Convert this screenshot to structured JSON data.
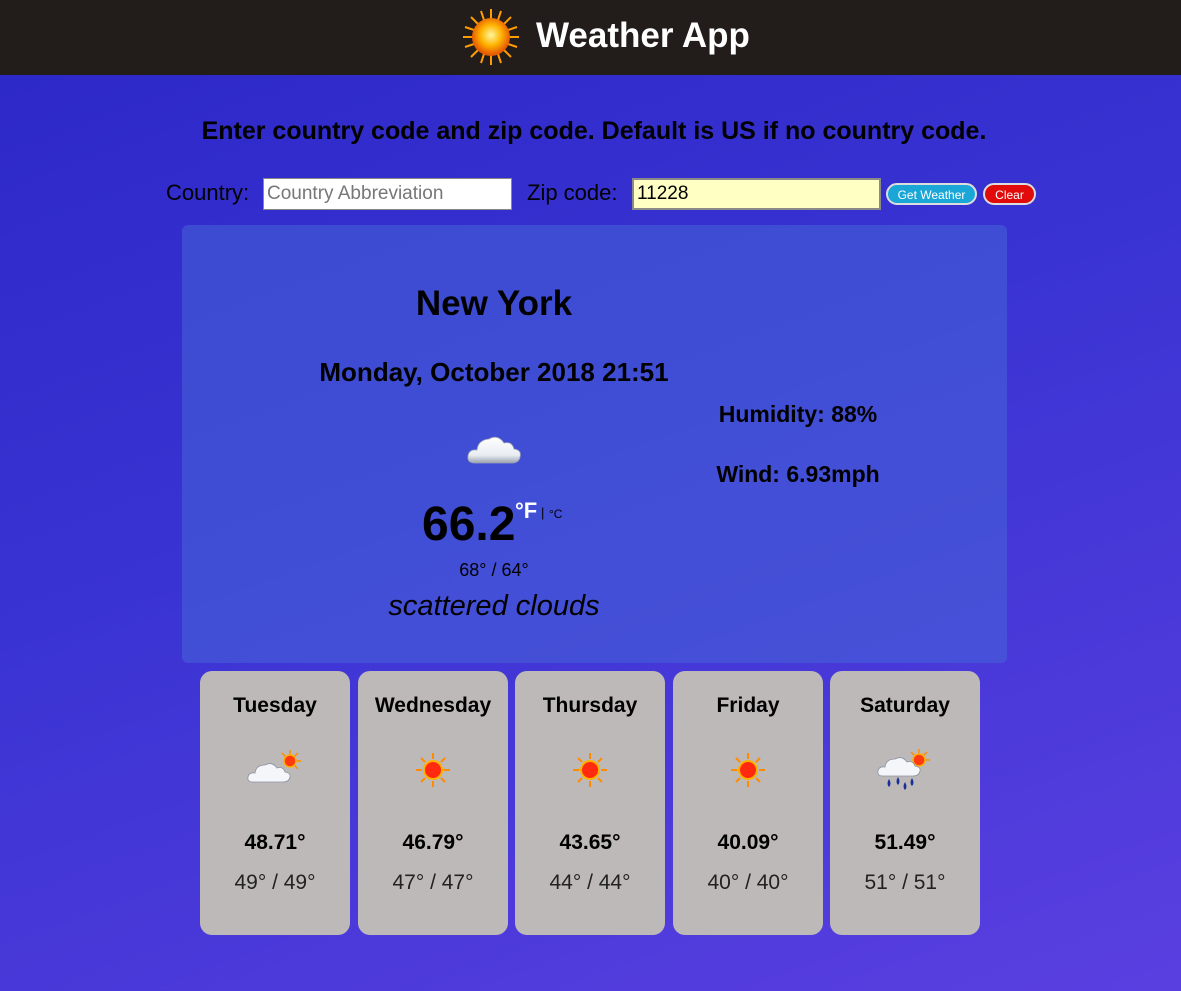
{
  "header": {
    "title": "Weather App",
    "logo_icon": "sun-icon"
  },
  "instructions": "Enter country code and zip code. Default is US if no country code.",
  "form": {
    "country_label": "Country:",
    "country_placeholder": "Country Abbreviation",
    "country_value": "",
    "zip_label": "Zip code:",
    "zip_value": "11228",
    "get_weather_label": "Get Weather",
    "clear_label": "Clear"
  },
  "current": {
    "city": "New York",
    "datetime": "Monday, October 2018 21:51",
    "icon": "cloud-icon",
    "temperature": "66.2",
    "unit_f": "°F",
    "unit_separator": "|",
    "unit_c": "°C",
    "high_low": "68° / 64°",
    "description": "scattered clouds",
    "humidity": "Humidity: 88%",
    "wind": "Wind: 6.93mph"
  },
  "forecast": [
    {
      "day": "Tuesday",
      "icon": "partly-cloudy-icon",
      "temp": "48.71°",
      "high_low": "49° / 49°"
    },
    {
      "day": "Wednesday",
      "icon": "sun-icon",
      "temp": "46.79°",
      "high_low": "47° / 47°"
    },
    {
      "day": "Thursday",
      "icon": "sun-icon",
      "temp": "43.65°",
      "high_low": "44° / 44°"
    },
    {
      "day": "Friday",
      "icon": "sun-icon",
      "temp": "40.09°",
      "high_low": "40° / 40°"
    },
    {
      "day": "Saturday",
      "icon": "rain-sun-icon",
      "temp": "51.49°",
      "high_low": "51° / 51°"
    }
  ],
  "colors": {
    "header_bg": "#221c1b",
    "get_weather_button": "#1ba6d8",
    "clear_button": "#e20b0b",
    "zip_input_bg": "#ffffc4",
    "forecast_card_bg": "#bdb9b9"
  }
}
